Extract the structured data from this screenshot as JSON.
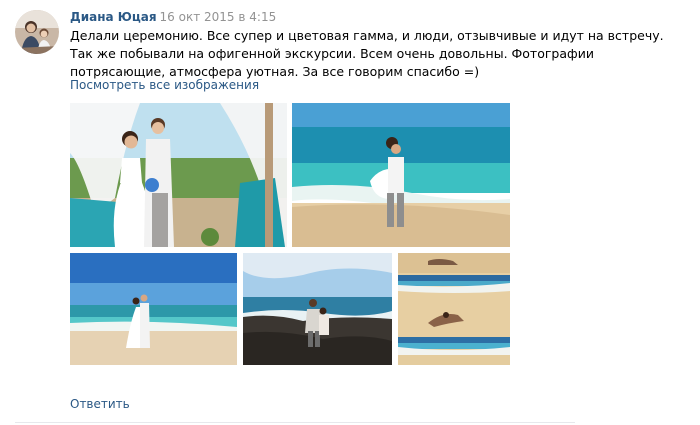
{
  "comment": {
    "author": "Диана Юцая",
    "date": "16 окт 2015 в 4:15",
    "text": "Делали церемонию. Все супер и цветовая гамма, и люди, отзывчивые и идут на встречу. Так же побывали на офигенной экскурсии. Всем очень довольны. Фотографии потрясающие, атмосфера уютная. За все говорим спасибо =)",
    "see_all_images": "Посмотреть все изображения",
    "reply": "Ответить"
  },
  "colors": {
    "link": "#2a5885",
    "date": "#939393",
    "divider": "#e7e8ec"
  },
  "photos": [
    {
      "name": "photo-ceremony-arch"
    },
    {
      "name": "photo-beach-couple-lift"
    },
    {
      "name": "photo-beach-couple-walk"
    },
    {
      "name": "photo-rocky-shore-couple"
    },
    {
      "name": "photo-beach-couple-lying"
    }
  ]
}
